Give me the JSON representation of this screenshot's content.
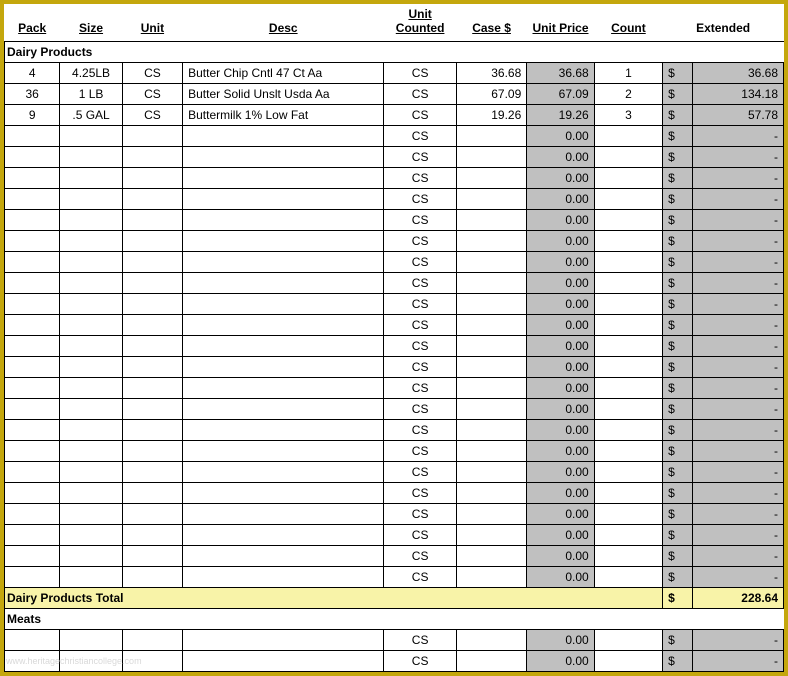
{
  "headers": {
    "pack": "Pack",
    "size": "Size",
    "unit": "Unit",
    "desc": "Desc",
    "unit_counted": "Unit Counted",
    "case_dollar": "Case $",
    "unit_price": "Unit Price",
    "count": "Count",
    "extended": "Extended"
  },
  "sections": [
    {
      "title": "Dairy Products",
      "rows": [
        {
          "pack": "4",
          "size": "4.25LB",
          "unit": "CS",
          "desc": "Butter Chip Cntl 47 Ct Aa",
          "unit_counted": "CS",
          "case": "36.68",
          "unit_price": "36.68",
          "count": "1",
          "curr": "$",
          "ext": "36.68"
        },
        {
          "pack": "36",
          "size": "1 LB",
          "unit": "CS",
          "desc": "Butter Solid Unslt Usda Aa",
          "unit_counted": "CS",
          "case": "67.09",
          "unit_price": "67.09",
          "count": "2",
          "curr": "$",
          "ext": "134.18"
        },
        {
          "pack": "9",
          "size": ".5 GAL",
          "unit": "CS",
          "desc": "Buttermilk 1% Low Fat",
          "unit_counted": "CS",
          "case": "19.26",
          "unit_price": "19.26",
          "count": "3",
          "curr": "$",
          "ext": "57.78"
        },
        {
          "pack": "",
          "size": "",
          "unit": "",
          "desc": "",
          "unit_counted": "CS",
          "case": "",
          "unit_price": "0.00",
          "count": "",
          "curr": "$",
          "ext": "-"
        },
        {
          "pack": "",
          "size": "",
          "unit": "",
          "desc": "",
          "unit_counted": "CS",
          "case": "",
          "unit_price": "0.00",
          "count": "",
          "curr": "$",
          "ext": "-"
        },
        {
          "pack": "",
          "size": "",
          "unit": "",
          "desc": "",
          "unit_counted": "CS",
          "case": "",
          "unit_price": "0.00",
          "count": "",
          "curr": "$",
          "ext": "-"
        },
        {
          "pack": "",
          "size": "",
          "unit": "",
          "desc": "",
          "unit_counted": "CS",
          "case": "",
          "unit_price": "0.00",
          "count": "",
          "curr": "$",
          "ext": "-"
        },
        {
          "pack": "",
          "size": "",
          "unit": "",
          "desc": "",
          "unit_counted": "CS",
          "case": "",
          "unit_price": "0.00",
          "count": "",
          "curr": "$",
          "ext": "-"
        },
        {
          "pack": "",
          "size": "",
          "unit": "",
          "desc": "",
          "unit_counted": "CS",
          "case": "",
          "unit_price": "0.00",
          "count": "",
          "curr": "$",
          "ext": "-"
        },
        {
          "pack": "",
          "size": "",
          "unit": "",
          "desc": "",
          "unit_counted": "CS",
          "case": "",
          "unit_price": "0.00",
          "count": "",
          "curr": "$",
          "ext": "-"
        },
        {
          "pack": "",
          "size": "",
          "unit": "",
          "desc": "",
          "unit_counted": "CS",
          "case": "",
          "unit_price": "0.00",
          "count": "",
          "curr": "$",
          "ext": "-"
        },
        {
          "pack": "",
          "size": "",
          "unit": "",
          "desc": "",
          "unit_counted": "CS",
          "case": "",
          "unit_price": "0.00",
          "count": "",
          "curr": "$",
          "ext": "-"
        },
        {
          "pack": "",
          "size": "",
          "unit": "",
          "desc": "",
          "unit_counted": "CS",
          "case": "",
          "unit_price": "0.00",
          "count": "",
          "curr": "$",
          "ext": "-"
        },
        {
          "pack": "",
          "size": "",
          "unit": "",
          "desc": "",
          "unit_counted": "CS",
          "case": "",
          "unit_price": "0.00",
          "count": "",
          "curr": "$",
          "ext": "-"
        },
        {
          "pack": "",
          "size": "",
          "unit": "",
          "desc": "",
          "unit_counted": "CS",
          "case": "",
          "unit_price": "0.00",
          "count": "",
          "curr": "$",
          "ext": "-"
        },
        {
          "pack": "",
          "size": "",
          "unit": "",
          "desc": "",
          "unit_counted": "CS",
          "case": "",
          "unit_price": "0.00",
          "count": "",
          "curr": "$",
          "ext": "-"
        },
        {
          "pack": "",
          "size": "",
          "unit": "",
          "desc": "",
          "unit_counted": "CS",
          "case": "",
          "unit_price": "0.00",
          "count": "",
          "curr": "$",
          "ext": "-"
        },
        {
          "pack": "",
          "size": "",
          "unit": "",
          "desc": "",
          "unit_counted": "CS",
          "case": "",
          "unit_price": "0.00",
          "count": "",
          "curr": "$",
          "ext": "-"
        },
        {
          "pack": "",
          "size": "",
          "unit": "",
          "desc": "",
          "unit_counted": "CS",
          "case": "",
          "unit_price": "0.00",
          "count": "",
          "curr": "$",
          "ext": "-"
        },
        {
          "pack": "",
          "size": "",
          "unit": "",
          "desc": "",
          "unit_counted": "CS",
          "case": "",
          "unit_price": "0.00",
          "count": "",
          "curr": "$",
          "ext": "-"
        },
        {
          "pack": "",
          "size": "",
          "unit": "",
          "desc": "",
          "unit_counted": "CS",
          "case": "",
          "unit_price": "0.00",
          "count": "",
          "curr": "$",
          "ext": "-"
        },
        {
          "pack": "",
          "size": "",
          "unit": "",
          "desc": "",
          "unit_counted": "CS",
          "case": "",
          "unit_price": "0.00",
          "count": "",
          "curr": "$",
          "ext": "-"
        },
        {
          "pack": "",
          "size": "",
          "unit": "",
          "desc": "",
          "unit_counted": "CS",
          "case": "",
          "unit_price": "0.00",
          "count": "",
          "curr": "$",
          "ext": "-"
        },
        {
          "pack": "",
          "size": "",
          "unit": "",
          "desc": "",
          "unit_counted": "CS",
          "case": "",
          "unit_price": "0.00",
          "count": "",
          "curr": "$",
          "ext": "-"
        },
        {
          "pack": "",
          "size": "",
          "unit": "",
          "desc": "",
          "unit_counted": "CS",
          "case": "",
          "unit_price": "0.00",
          "count": "",
          "curr": "$",
          "ext": "-"
        }
      ],
      "total_label": "Dairy Products Total",
      "total_curr": "$",
      "total_value": "228.64"
    },
    {
      "title": "Meats",
      "rows": [
        {
          "pack": "",
          "size": "",
          "unit": "",
          "desc": "",
          "unit_counted": "CS",
          "case": "",
          "unit_price": "0.00",
          "count": "",
          "curr": "$",
          "ext": "-"
        },
        {
          "pack": "",
          "size": "",
          "unit": "",
          "desc": "",
          "unit_counted": "CS",
          "case": "",
          "unit_price": "0.00",
          "count": "",
          "curr": "$",
          "ext": "-"
        }
      ]
    }
  ],
  "watermark": "www.heritagechristiancollege.com"
}
